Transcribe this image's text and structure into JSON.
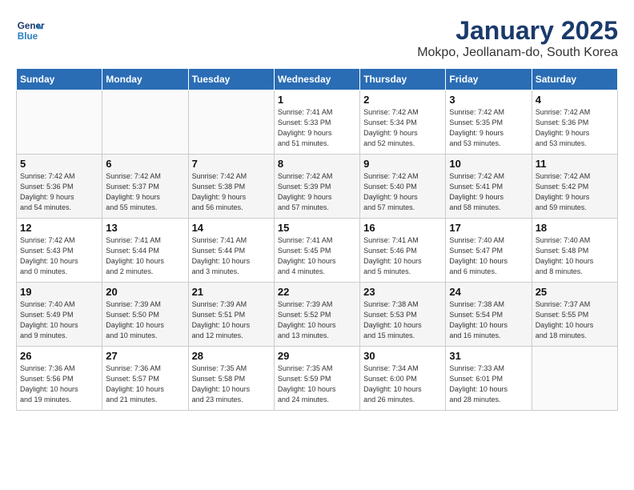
{
  "header": {
    "logo_line1": "General",
    "logo_line2": "Blue",
    "title": "January 2025",
    "subtitle": "Mokpo, Jeollanam-do, South Korea"
  },
  "days_of_week": [
    "Sunday",
    "Monday",
    "Tuesday",
    "Wednesday",
    "Thursday",
    "Friday",
    "Saturday"
  ],
  "weeks": [
    [
      {
        "day": "",
        "info": ""
      },
      {
        "day": "",
        "info": ""
      },
      {
        "day": "",
        "info": ""
      },
      {
        "day": "1",
        "info": "Sunrise: 7:41 AM\nSunset: 5:33 PM\nDaylight: 9 hours\nand 51 minutes."
      },
      {
        "day": "2",
        "info": "Sunrise: 7:42 AM\nSunset: 5:34 PM\nDaylight: 9 hours\nand 52 minutes."
      },
      {
        "day": "3",
        "info": "Sunrise: 7:42 AM\nSunset: 5:35 PM\nDaylight: 9 hours\nand 53 minutes."
      },
      {
        "day": "4",
        "info": "Sunrise: 7:42 AM\nSunset: 5:36 PM\nDaylight: 9 hours\nand 53 minutes."
      }
    ],
    [
      {
        "day": "5",
        "info": "Sunrise: 7:42 AM\nSunset: 5:36 PM\nDaylight: 9 hours\nand 54 minutes."
      },
      {
        "day": "6",
        "info": "Sunrise: 7:42 AM\nSunset: 5:37 PM\nDaylight: 9 hours\nand 55 minutes."
      },
      {
        "day": "7",
        "info": "Sunrise: 7:42 AM\nSunset: 5:38 PM\nDaylight: 9 hours\nand 56 minutes."
      },
      {
        "day": "8",
        "info": "Sunrise: 7:42 AM\nSunset: 5:39 PM\nDaylight: 9 hours\nand 57 minutes."
      },
      {
        "day": "9",
        "info": "Sunrise: 7:42 AM\nSunset: 5:40 PM\nDaylight: 9 hours\nand 57 minutes."
      },
      {
        "day": "10",
        "info": "Sunrise: 7:42 AM\nSunset: 5:41 PM\nDaylight: 9 hours\nand 58 minutes."
      },
      {
        "day": "11",
        "info": "Sunrise: 7:42 AM\nSunset: 5:42 PM\nDaylight: 9 hours\nand 59 minutes."
      }
    ],
    [
      {
        "day": "12",
        "info": "Sunrise: 7:42 AM\nSunset: 5:43 PM\nDaylight: 10 hours\nand 0 minutes."
      },
      {
        "day": "13",
        "info": "Sunrise: 7:41 AM\nSunset: 5:44 PM\nDaylight: 10 hours\nand 2 minutes."
      },
      {
        "day": "14",
        "info": "Sunrise: 7:41 AM\nSunset: 5:44 PM\nDaylight: 10 hours\nand 3 minutes."
      },
      {
        "day": "15",
        "info": "Sunrise: 7:41 AM\nSunset: 5:45 PM\nDaylight: 10 hours\nand 4 minutes."
      },
      {
        "day": "16",
        "info": "Sunrise: 7:41 AM\nSunset: 5:46 PM\nDaylight: 10 hours\nand 5 minutes."
      },
      {
        "day": "17",
        "info": "Sunrise: 7:40 AM\nSunset: 5:47 PM\nDaylight: 10 hours\nand 6 minutes."
      },
      {
        "day": "18",
        "info": "Sunrise: 7:40 AM\nSunset: 5:48 PM\nDaylight: 10 hours\nand 8 minutes."
      }
    ],
    [
      {
        "day": "19",
        "info": "Sunrise: 7:40 AM\nSunset: 5:49 PM\nDaylight: 10 hours\nand 9 minutes."
      },
      {
        "day": "20",
        "info": "Sunrise: 7:39 AM\nSunset: 5:50 PM\nDaylight: 10 hours\nand 10 minutes."
      },
      {
        "day": "21",
        "info": "Sunrise: 7:39 AM\nSunset: 5:51 PM\nDaylight: 10 hours\nand 12 minutes."
      },
      {
        "day": "22",
        "info": "Sunrise: 7:39 AM\nSunset: 5:52 PM\nDaylight: 10 hours\nand 13 minutes."
      },
      {
        "day": "23",
        "info": "Sunrise: 7:38 AM\nSunset: 5:53 PM\nDaylight: 10 hours\nand 15 minutes."
      },
      {
        "day": "24",
        "info": "Sunrise: 7:38 AM\nSunset: 5:54 PM\nDaylight: 10 hours\nand 16 minutes."
      },
      {
        "day": "25",
        "info": "Sunrise: 7:37 AM\nSunset: 5:55 PM\nDaylight: 10 hours\nand 18 minutes."
      }
    ],
    [
      {
        "day": "26",
        "info": "Sunrise: 7:36 AM\nSunset: 5:56 PM\nDaylight: 10 hours\nand 19 minutes."
      },
      {
        "day": "27",
        "info": "Sunrise: 7:36 AM\nSunset: 5:57 PM\nDaylight: 10 hours\nand 21 minutes."
      },
      {
        "day": "28",
        "info": "Sunrise: 7:35 AM\nSunset: 5:58 PM\nDaylight: 10 hours\nand 23 minutes."
      },
      {
        "day": "29",
        "info": "Sunrise: 7:35 AM\nSunset: 5:59 PM\nDaylight: 10 hours\nand 24 minutes."
      },
      {
        "day": "30",
        "info": "Sunrise: 7:34 AM\nSunset: 6:00 PM\nDaylight: 10 hours\nand 26 minutes."
      },
      {
        "day": "31",
        "info": "Sunrise: 7:33 AM\nSunset: 6:01 PM\nDaylight: 10 hours\nand 28 minutes."
      },
      {
        "day": "",
        "info": ""
      }
    ]
  ]
}
